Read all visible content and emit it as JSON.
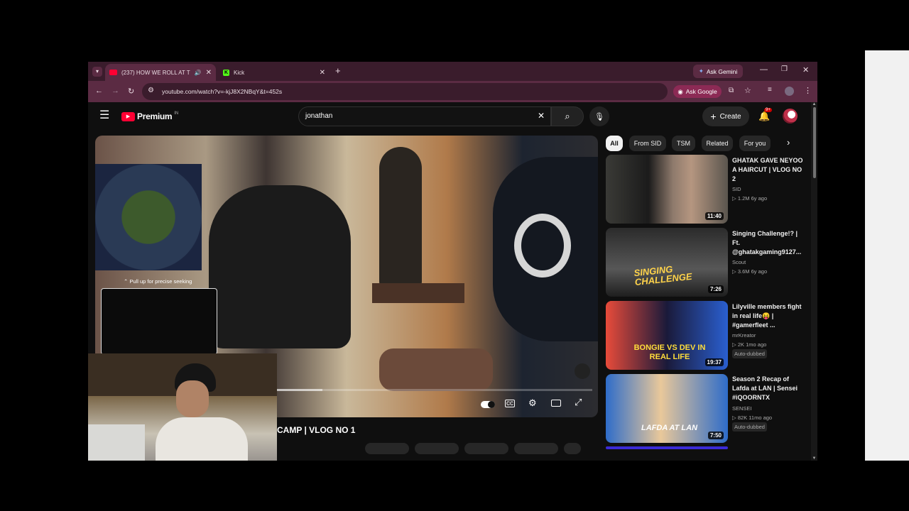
{
  "browser": {
    "tabs": [
      {
        "label": "(237) HOW WE ROLL AT TH",
        "favicon": "youtube-icon"
      },
      {
        "label": "Kick",
        "favicon": "kick-icon"
      }
    ],
    "ask_gemini": "Ask Gemini",
    "url": "youtube.com/watch?v=-kjJ8X2NBqY&t=452s",
    "ask_google": "Ask Google"
  },
  "youtube": {
    "logo": "Premium",
    "region": "IN",
    "search_value": "jonathan",
    "create_label": "Create",
    "notification_count": "9+"
  },
  "player": {
    "seek_hint": "⌃ Pull up for precise seeking",
    "video_title_fragment": "CAMP | VLOG NO 1"
  },
  "chips": [
    "All",
    "From SID",
    "TSM",
    "Related",
    "For you"
  ],
  "recommendations": [
    {
      "title": "GHATAK GAVE NEYOO A HAIRCUT | VLOG NO 2",
      "channel": "SID",
      "stats": "▷ 1.2M   6y ago",
      "duration": "11:40",
      "badge": "",
      "thumb_text": ""
    },
    {
      "title": "Singing Challenge!? | Ft. @ghatakgaming9127...",
      "channel": "Scout",
      "stats": "▷ 3.6M   6y ago",
      "duration": "7:26",
      "badge": "",
      "thumb_text": "SINGING CHALLENGE"
    },
    {
      "title": "Lilyville members fight in real life😝 | #gamerfleet ...",
      "channel": "mrKreator",
      "stats": "▷ 2K   1mo ago",
      "duration": "19:37",
      "badge": "Auto-dubbed",
      "thumb_text": "BONGIE VS DEV IN REAL LIFE"
    },
    {
      "title": "Season 2 Recap of Lafda at LAN | Sensei #iQOORNTX",
      "channel": "SENSEI",
      "stats": "▷ 82K   11mo ago",
      "duration": "7:50",
      "badge": "Auto-dubbed",
      "thumb_text": "LAFDA AT LAN"
    }
  ],
  "colors": {
    "tab_strip": "#3a1c2c",
    "toolbar": "#5b2b43",
    "yt_bg": "#0f0f0f",
    "yt_red": "#ff0033"
  }
}
